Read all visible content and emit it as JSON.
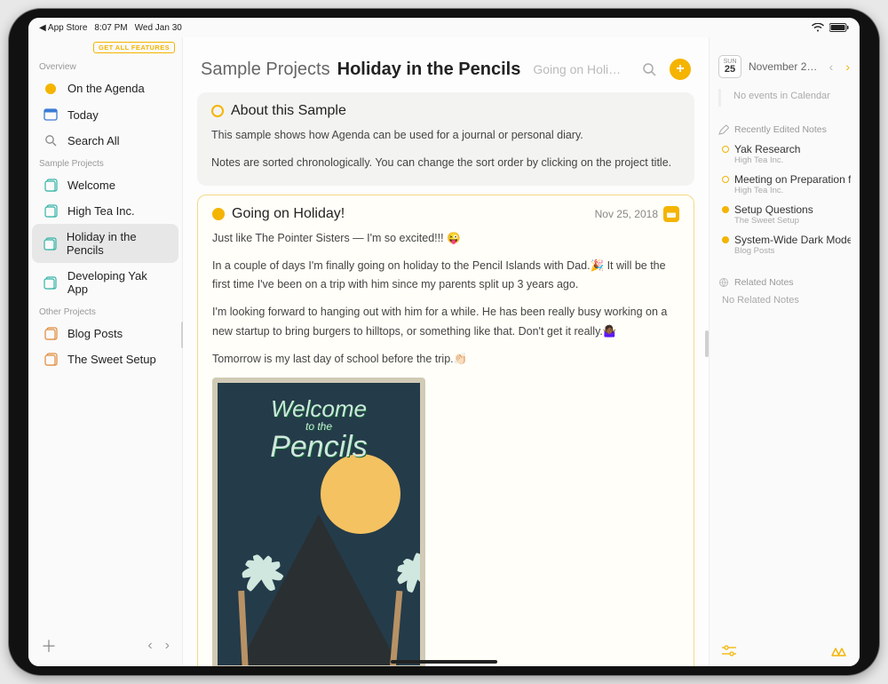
{
  "status": {
    "back_app": "◀ App Store",
    "time": "8:07 PM",
    "date": "Wed Jan 30"
  },
  "sidebar": {
    "feature_label": "GET ALL FEATURES",
    "sections": {
      "overview_label": "Overview",
      "sample_label": "Sample Projects",
      "other_label": "Other Projects"
    },
    "overview": [
      {
        "label": "On the Agenda"
      },
      {
        "label": "Today"
      },
      {
        "label": "Search All"
      }
    ],
    "sample": [
      {
        "label": "Welcome"
      },
      {
        "label": "High Tea Inc."
      },
      {
        "label": "Holiday in the Pencils"
      },
      {
        "label": "Developing Yak App"
      }
    ],
    "other": [
      {
        "label": "Blog Posts"
      },
      {
        "label": "The Sweet Setup"
      }
    ]
  },
  "main": {
    "breadcrumb_parent": "Sample Projects",
    "breadcrumb_title": "Holiday in the Pencils",
    "breadcrumb_sub": "Going on Holi…",
    "about_card": {
      "title": "About this Sample",
      "p1": "This sample shows how Agenda can be used for a journal or personal diary.",
      "p2": "Notes are sorted chronologically. You can change the sort order by clicking on the project title."
    },
    "holiday_card": {
      "title": "Going on Holiday!",
      "date": "Nov 25, 2018",
      "p1": "Just like The Pointer Sisters — I'm so excited!!! 😜",
      "p2": "In a couple of days I'm finally going on holiday to the Pencil Islands with Dad.🎉 It will be the first time I've been on a trip with him since my parents split up 3 years ago.",
      "p3": "I'm looking forward to hanging out with him for a while. He has been really busy working on a new startup to bring burgers to hilltops, or something like that. Don't get it really.🤷🏾‍♀️",
      "p4": "Tomorrow is my last day of school before the trip.👏🏻",
      "postcard": {
        "line1": "Welcome",
        "line2": "to the",
        "line3": "Pencils"
      }
    }
  },
  "rightbar": {
    "cal_day_label": "SUN",
    "cal_day_num": "25",
    "month_label": "November 20…",
    "no_events": "No events in Calendar",
    "recent_label": "Recently Edited Notes",
    "recent": [
      {
        "title": "Yak Research",
        "sub": "High Tea Inc."
      },
      {
        "title": "Meeting on Preparation f…",
        "sub": "High Tea Inc."
      },
      {
        "title": "Setup Questions",
        "sub": "The Sweet Setup"
      },
      {
        "title": "System-Wide Dark Mode…",
        "sub": "Blog Posts"
      }
    ],
    "related_label": "Related Notes",
    "no_related": "No Related Notes"
  }
}
